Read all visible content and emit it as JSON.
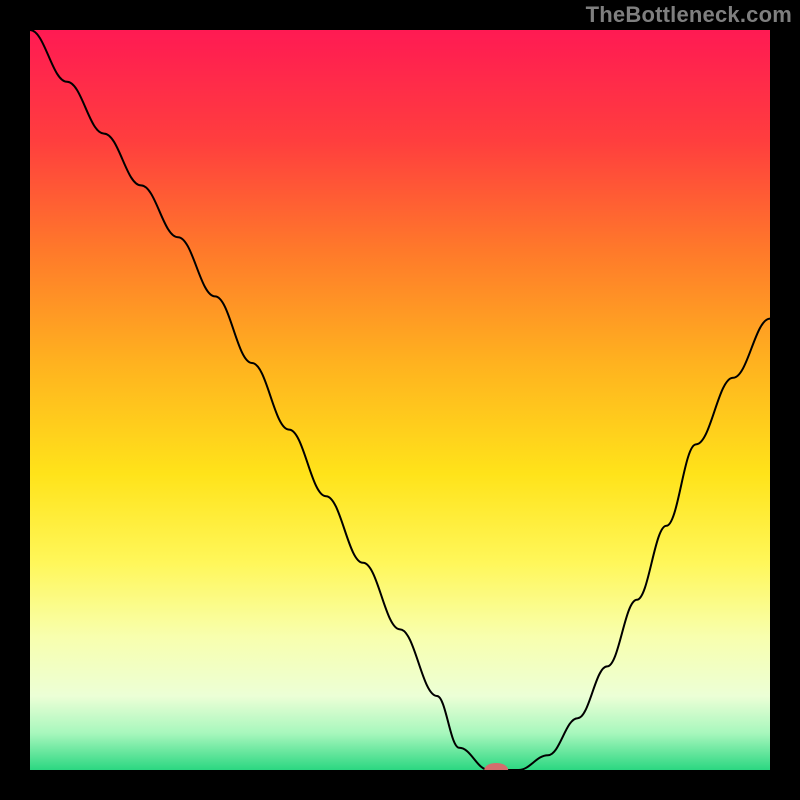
{
  "attribution": "TheBottleneck.com",
  "chart_data": {
    "type": "line",
    "title": "",
    "xlabel": "",
    "ylabel": "",
    "xlim": [
      0,
      100
    ],
    "ylim": [
      0,
      100
    ],
    "grid": false,
    "legend": false,
    "background_gradient": {
      "stops": [
        {
          "offset": 0.0,
          "color": "#ff1a53"
        },
        {
          "offset": 0.15,
          "color": "#ff3e3e"
        },
        {
          "offset": 0.3,
          "color": "#ff7a2a"
        },
        {
          "offset": 0.45,
          "color": "#ffb21f"
        },
        {
          "offset": 0.6,
          "color": "#ffe31a"
        },
        {
          "offset": 0.72,
          "color": "#fff75a"
        },
        {
          "offset": 0.82,
          "color": "#f8ffae"
        },
        {
          "offset": 0.9,
          "color": "#ecffd6"
        },
        {
          "offset": 0.95,
          "color": "#a8f7bd"
        },
        {
          "offset": 1.0,
          "color": "#2bd781"
        }
      ]
    },
    "series": [
      {
        "name": "curve",
        "color": "#000000",
        "stroke_width": 2,
        "x": [
          0,
          5,
          10,
          15,
          20,
          25,
          30,
          35,
          40,
          45,
          50,
          55,
          58,
          62,
          66,
          70,
          74,
          78,
          82,
          86,
          90,
          95,
          100
        ],
        "y": [
          100,
          93,
          86,
          79,
          72,
          64,
          55,
          46,
          37,
          28,
          19,
          10,
          3,
          0,
          0,
          2,
          7,
          14,
          23,
          33,
          44,
          53,
          61
        ]
      }
    ],
    "marker": {
      "name": "optimum-marker",
      "x": 63,
      "y": 0,
      "rx": 12,
      "ry": 7,
      "fill": "#d46d6d"
    }
  }
}
